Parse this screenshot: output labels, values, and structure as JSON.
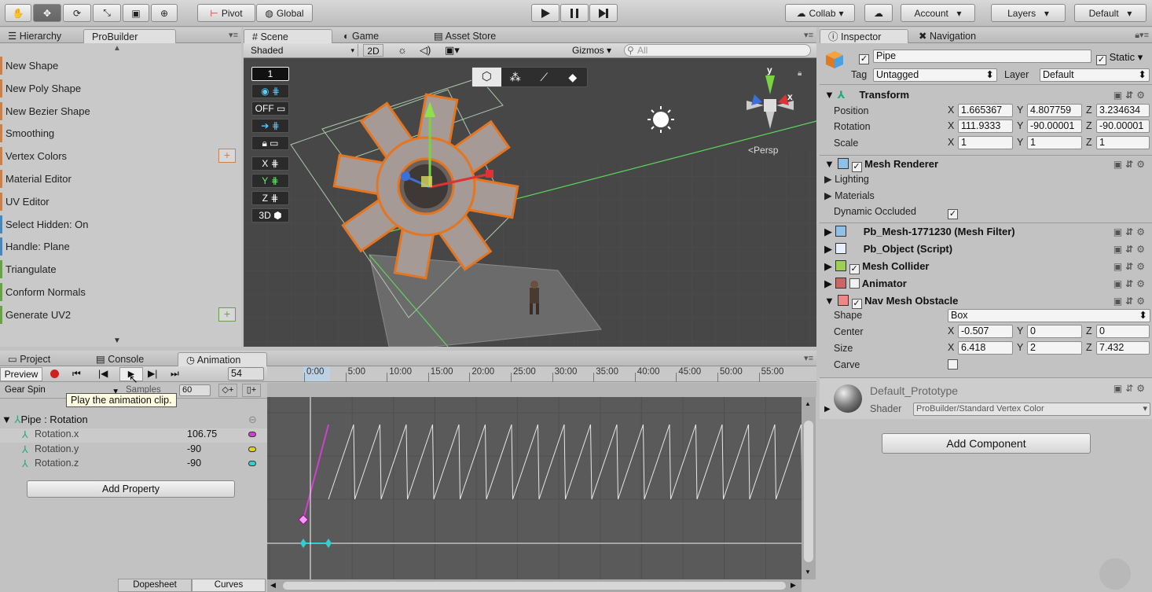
{
  "toolbar": {
    "pivot": "Pivot",
    "global": "Global",
    "collab": "Collab",
    "account": "Account",
    "layers": "Layers",
    "layout": "Default"
  },
  "left_tabs": {
    "hierarchy": "Hierarchy",
    "probuilder": "ProBuilder"
  },
  "probuilder_items": [
    {
      "label": "New Shape",
      "color": "#c8824e",
      "plus": false
    },
    {
      "label": "New Poly Shape",
      "color": "#c8824e",
      "plus": false
    },
    {
      "label": "New Bezier Shape",
      "color": "#c8824e",
      "plus": false
    },
    {
      "label": "Smoothing",
      "color": "#c8824e",
      "plus": false
    },
    {
      "label": "Vertex Colors",
      "color": "#c8824e",
      "plus": true
    },
    {
      "label": "Material Editor",
      "color": "#c8824e",
      "plus": false
    },
    {
      "label": "UV Editor",
      "color": "#c8824e",
      "plus": false
    },
    {
      "label": "Select Hidden: On",
      "color": "#4a86b8",
      "plus": false
    },
    {
      "label": "Handle: Plane",
      "color": "#4a86b8",
      "plus": false
    },
    {
      "label": "Triangulate",
      "color": "#6aa04a",
      "plus": false
    },
    {
      "label": "Conform Normals",
      "color": "#6aa04a",
      "plus": false
    },
    {
      "label": "Generate UV2",
      "color": "#6aa04a",
      "plus": true
    }
  ],
  "scene_tabs": {
    "scene": "Scene",
    "game": "Game",
    "asset_store": "Asset Store"
  },
  "scene_bar": {
    "shading": "Shaded",
    "mode2d": "2D",
    "gizmos": "Gizmos",
    "search_placeholder": "All"
  },
  "scene": {
    "persp": "Persp",
    "btn1": "1",
    "off": "OFF",
    "x": "X",
    "y": "Y",
    "z": "Z",
    "btn3d": "3D",
    "axis_x": "x",
    "axis_y": "y"
  },
  "inspector_tabs": {
    "inspector": "Inspector",
    "navigation": "Navigation"
  },
  "object": {
    "name": "Pipe",
    "static": "Static",
    "tag_label": "Tag",
    "tag": "Untagged",
    "layer_label": "Layer",
    "layer": "Default"
  },
  "transform": {
    "title": "Transform",
    "position_label": "Position",
    "rotation_label": "Rotation",
    "scale_label": "Scale",
    "pos": [
      "1.665367",
      "4.807759",
      "3.234634"
    ],
    "rot": [
      "111.9333",
      "-90.00001",
      "-90.00001"
    ],
    "scale": [
      "1",
      "1",
      "1"
    ]
  },
  "axes": {
    "x": "X",
    "y": "Y",
    "z": "Z"
  },
  "mesh_renderer": {
    "title": "Mesh Renderer",
    "lighting": "Lighting",
    "materials": "Materials",
    "dynamic": "Dynamic Occluded"
  },
  "components": {
    "mesh_filter": "Pb_Mesh-1771230 (Mesh Filter)",
    "pb_object": "Pb_Object (Script)",
    "mesh_collider": "Mesh Collider",
    "animator": "Animator",
    "nav_obstacle": "Nav Mesh Obstacle"
  },
  "nav": {
    "shape_label": "Shape",
    "shape": "Box",
    "center_label": "Center",
    "center": [
      "-0.507",
      "0",
      "0"
    ],
    "size_label": "Size",
    "size": [
      "6.418",
      "2",
      "7.432"
    ],
    "carve_label": "Carve"
  },
  "material": {
    "name": "Default_Prototype",
    "shader_label": "Shader",
    "shader": "ProBuilder/Standard Vertex Color"
  },
  "add_component": "Add Component",
  "bottom_tabs": {
    "project": "Project",
    "console": "Console",
    "animation": "Animation"
  },
  "anim": {
    "preview": "Preview",
    "frame": "54",
    "clip": "Gear Spin",
    "samples_label": "Samples",
    "samples": "60",
    "tooltip": "Play the animation clip.",
    "property": "Pipe : Rotation",
    "add_property": "Add Property",
    "dopesheet": "Dopesheet",
    "curves": "Curves"
  },
  "anim_props": [
    {
      "name": "Rotation.x",
      "value": "106.75",
      "color": "#d040d0"
    },
    {
      "name": "Rotation.y",
      "value": "-90",
      "color": "#e0d020"
    },
    {
      "name": "Rotation.z",
      "value": "-90",
      "color": "#30d0d0"
    }
  ],
  "timeline": [
    "0:00",
    "5:00",
    "10:00",
    "15:00",
    "20:00",
    "25:00",
    "30:00",
    "35:00",
    "40:00",
    "45:00",
    "50:00",
    "55:00"
  ]
}
